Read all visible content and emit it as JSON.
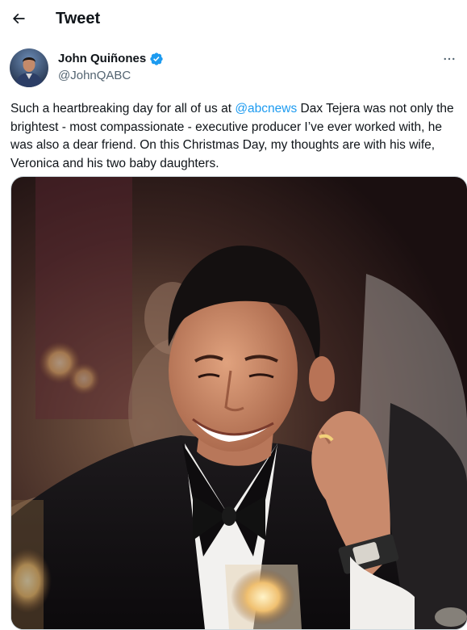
{
  "header": {
    "title": "Tweet",
    "back_icon": "arrow-left-icon"
  },
  "author": {
    "name": "John Quiñones",
    "handle": "@JohnQABC",
    "verified_icon": "verified-badge-icon",
    "verified_color": "#1d9bf0",
    "more_icon": "more-horizontal-icon"
  },
  "tweet": {
    "text_before": "Such a heartbreaking day for all of us at ",
    "mention": "@abcnews",
    "text_after": " Dax Tejera was not only the brightest - most compassionate - executive producer I’ve ever worked with, he was also a dear friend. On this Christmas Day, my thoughts are with his wife, Veronica and his two baby daughters.",
    "media_kind": "photo"
  },
  "colors": {
    "text_primary": "#0f1419",
    "text_secondary": "#536471",
    "accent": "#1d9bf0"
  }
}
